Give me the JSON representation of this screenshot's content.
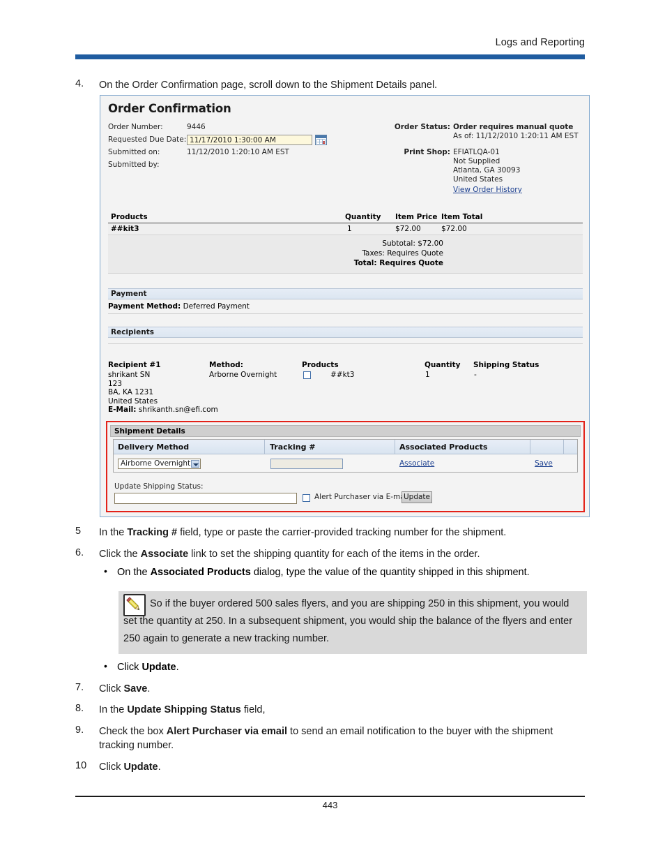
{
  "header": {
    "title": "Logs and Reporting"
  },
  "footer": {
    "page_number": "443"
  },
  "steps": {
    "s4_num": "4.",
    "s4_pre": "On the Order Confirmation page, scroll down to the Shipment Details panel.",
    "s5_num": "5",
    "s5_a": "In the ",
    "s5_b": "Tracking #",
    "s5_c": " field, type or paste the carrier-provided tracking number for the shipment.",
    "s6_num": "6.",
    "s6_a": "Click the ",
    "s6_b": "Associate",
    "s6_c": " link to set the shipping quantity for each of the items in the order.",
    "b1_dot": "•",
    "b1_a": "On the ",
    "b1_b": "Associated Products",
    "b1_c": " dialog, type the value of the quantity shipped in this shipment.",
    "b2_dot": "•",
    "b2_a": "Click ",
    "b2_b": "Update",
    "b2_c": ".",
    "s7_num": "7.",
    "s7_a": "Click ",
    "s7_b": "Save",
    "s7_c": ".",
    "s8_num": "8.",
    "s8_a": "In the ",
    "s8_b": "Update Shipping Status",
    "s8_c": " field,",
    "s9_num": "9.",
    "s9_a": "Check the box ",
    "s9_b": "Alert Purchaser via email",
    "s9_c": " to send an email notification to the buyer with the shipment tracking number.",
    "s10_num": "10",
    "s10_a": "Click ",
    "s10_b": "Update",
    "s10_c": "."
  },
  "note": {
    "icon": "pencil-icon",
    "text": "So if the buyer ordered 500 sales flyers, and you are shipping 250 in this shipment, you would set the quantity at 250. In a subsequent shipment, you would ship the balance of the flyers and enter 250 again to generate a new tracking number."
  },
  "screenshot": {
    "title": "Order Confirmation",
    "order_info": {
      "order_number_label": "Order Number:",
      "order_number_value": "9446",
      "requested_due_date_label": "Requested Due Date:",
      "requested_due_date_value": "11/17/2010 1:30:00 AM",
      "calendar_icon": "calendar-icon",
      "submitted_on_label": "Submitted on:",
      "submitted_on_value": "11/12/2010 1:20:10 AM EST",
      "submitted_by_label": "Submitted by:",
      "submitted_by_value": ""
    },
    "order_status": {
      "label": "Order Status:",
      "value": "Order requires manual quote",
      "as_of": "As of: 11/12/2010 1:20:11 AM EST"
    },
    "print_shop": {
      "label": "Print Shop:",
      "name": "EFIATLQA-01",
      "line2": "Not Supplied",
      "line3": "Atlanta, GA 30093",
      "line4": "United States",
      "history_link": "View Order History"
    },
    "products_table": {
      "headers": [
        "Products",
        "Quantity",
        "Item Price",
        "Item Total"
      ],
      "rows": [
        {
          "product": "##kit3",
          "quantity": "1",
          "item_price": "$72.00",
          "item_total": "$72.00"
        }
      ],
      "totals": [
        {
          "label": "Subtotal:",
          "value": "$72.00",
          "bold": false
        },
        {
          "label": "Taxes:",
          "value": "Requires Quote",
          "bold": false
        },
        {
          "label": "Total:",
          "value": "Requires Quote",
          "bold": true
        }
      ]
    },
    "payment": {
      "section_title": "Payment",
      "method_label": "Payment Method:",
      "method_value": "Deferred Payment"
    },
    "recipients": {
      "section_title": "Recipients",
      "headers": {
        "recipient": "Recipient #1",
        "method": "Method:",
        "products": "Products",
        "quantity": "Quantity",
        "shipping_status": "Shipping Status"
      },
      "address": [
        "shrikant SN",
        "123",
        "BA, KA 1231",
        "United States"
      ],
      "email_label": "E-Mail:",
      "email_value": "shrikanth.sn@efi.com",
      "method_value": "Arborne Overnight",
      "product_name": "##kt3",
      "quantity_value": "1",
      "shipping_status_value": "-"
    },
    "shipment_details": {
      "panel_title": "Shipment Details",
      "headers": [
        "Delivery Method",
        "Tracking #",
        "Associated Products",
        "",
        ""
      ],
      "delivery_method_value": "Airborne Overnight",
      "tracking_value": "",
      "associate_link": "Associate",
      "save_link": "Save",
      "update_status_label": "Update Shipping Status:",
      "update_status_value": "",
      "alert_checkbox_label": "Alert Purchaser via E-mail",
      "update_button": "Update"
    }
  },
  "colors": {
    "header_rule": "#1F5CA0",
    "highlight_border": "#E32219",
    "link": "#1B3F8F",
    "note_bg": "#D9D9D9"
  }
}
